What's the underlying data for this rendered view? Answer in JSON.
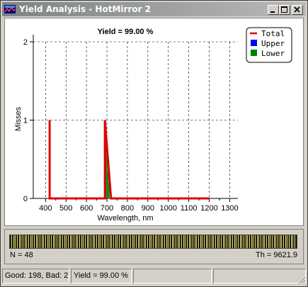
{
  "window": {
    "title": "Yield Analysis - HotMirror 2"
  },
  "colors": {
    "total": "#e00000",
    "upper": "#0000ff",
    "lower": "#008000"
  },
  "chart_data": {
    "type": "bar",
    "title": "Yield = 99.00 %",
    "xlabel": "Wavelength, nm",
    "ylabel": "Misses",
    "xlim": [
      340,
      1340
    ],
    "ylim": [
      0,
      2
    ],
    "x_ticks": [
      "400",
      "500",
      "600",
      "700",
      "800",
      "900",
      "1000",
      "1100",
      "1200",
      "1300"
    ],
    "y_ticks": [
      "0",
      "1",
      "2"
    ],
    "grid": true,
    "legend": {
      "position": "top-right",
      "entries": [
        "Total",
        "Upper",
        "Lower"
      ]
    },
    "series": [
      {
        "name": "Total",
        "kind": "line",
        "x": [
          420,
          420,
          420,
          690,
          690,
          690,
          720,
          1200
        ],
        "y": [
          0,
          1,
          0,
          0,
          1,
          1,
          0,
          0
        ]
      },
      {
        "name": "Upper",
        "kind": "bar",
        "x": [],
        "y": []
      },
      {
        "name": "Lower",
        "kind": "bar",
        "x": [
          695,
          700,
          705,
          710
        ],
        "y": [
          0.75,
          0.55,
          0.35,
          0.2
        ]
      }
    ]
  },
  "strip": {
    "n_label": "N = 48",
    "th_label": "Th = 9621.9"
  },
  "status": {
    "pane1": "Good: 198, Bad: 2",
    "pane2": "Yield = 99.00 %",
    "pane3": "",
    "pane4": ""
  }
}
